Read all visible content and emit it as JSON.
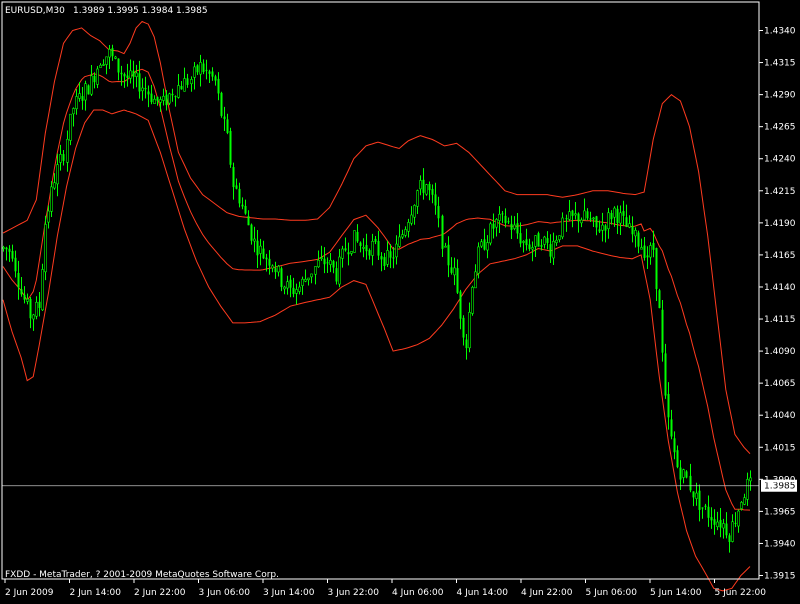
{
  "header": {
    "symbol_label": "EURUSD,M30",
    "ohlc_label": "1.3989 1.3995 1.3984 1.3985"
  },
  "footer": {
    "copyright": "FXDD - MetaTrader, ? 2001-2009 MetaQuotes Software Corp."
  },
  "colors": {
    "background": "#000000",
    "frame": "#ffffff",
    "bull_candle": "#00ff00",
    "bear_candle": "#00ff00",
    "band": "#ff3b1f",
    "price_line": "#c0c0c0",
    "price_tag_bg": "#ffffff",
    "price_tag_text": "#000000"
  },
  "chart_data": {
    "type": "line",
    "symbol": "EURUSD",
    "timeframe": "M30",
    "ylim": [
      1.3905,
      1.4355
    ],
    "y_ticks": [
      "1.4340",
      "1.4315",
      "1.4290",
      "1.4265",
      "1.4240",
      "1.4215",
      "1.4190",
      "1.4165",
      "1.4140",
      "1.4115",
      "1.4090",
      "1.4065",
      "1.4040",
      "1.4015",
      "1.3990",
      "1.3965",
      "1.3940",
      "1.3915"
    ],
    "x_ticks": [
      "2 Jun 2009",
      "2 Jun 14:00",
      "2 Jun 22:00",
      "3 Jun 06:00",
      "3 Jun 14:00",
      "3 Jun 22:00",
      "4 Jun 06:00",
      "4 Jun 14:00",
      "4 Jun 22:00",
      "5 Jun 06:00",
      "5 Jun 14:00",
      "5 Jun 22:00"
    ],
    "current_price": "1.3985",
    "price_series_knots": [
      [
        0,
        1.417
      ],
      [
        3,
        1.4168
      ],
      [
        6,
        1.4135
      ],
      [
        9,
        1.4118
      ],
      [
        12,
        1.4125
      ],
      [
        14,
        1.419
      ],
      [
        17,
        1.4225
      ],
      [
        20,
        1.4245
      ],
      [
        23,
        1.428
      ],
      [
        26,
        1.429
      ],
      [
        29,
        1.43
      ],
      [
        32,
        1.4318
      ],
      [
        35,
        1.4322
      ],
      [
        38,
        1.431
      ],
      [
        41,
        1.4303
      ],
      [
        44,
        1.43
      ],
      [
        47,
        1.4295
      ],
      [
        50,
        1.4286
      ],
      [
        53,
        1.4283
      ],
      [
        56,
        1.4293
      ],
      [
        59,
        1.4298
      ],
      [
        62,
        1.4302
      ],
      [
        65,
        1.4312
      ],
      [
        68,
        1.4305
      ],
      [
        70,
        1.43
      ],
      [
        72,
        1.4275
      ],
      [
        74,
        1.4255
      ],
      [
        76,
        1.422
      ],
      [
        78,
        1.421
      ],
      [
        80,
        1.4195
      ],
      [
        83,
        1.4175
      ],
      [
        86,
        1.4165
      ],
      [
        89,
        1.416
      ],
      [
        92,
        1.4145
      ],
      [
        95,
        1.4137
      ],
      [
        98,
        1.414
      ],
      [
        101,
        1.415
      ],
      [
        104,
        1.4158
      ],
      [
        107,
        1.416
      ],
      [
        110,
        1.415
      ],
      [
        113,
        1.417
      ],
      [
        116,
        1.4177
      ],
      [
        119,
        1.417
      ],
      [
        122,
        1.4172
      ],
      [
        125,
        1.4165
      ],
      [
        128,
        1.416
      ],
      [
        131,
        1.4175
      ],
      [
        134,
        1.4195
      ],
      [
        137,
        1.4215
      ],
      [
        140,
        1.422
      ],
      [
        143,
        1.42
      ],
      [
        146,
        1.4165
      ],
      [
        149,
        1.415
      ],
      [
        151,
        1.412
      ],
      [
        153,
        1.4095
      ],
      [
        155,
        1.4145
      ],
      [
        157,
        1.4165
      ],
      [
        160,
        1.418
      ],
      [
        163,
        1.419
      ],
      [
        166,
        1.4192
      ],
      [
        169,
        1.4185
      ],
      [
        172,
        1.4175
      ],
      [
        175,
        1.4172
      ],
      [
        178,
        1.4178
      ],
      [
        181,
        1.417
      ],
      [
        184,
        1.4185
      ],
      [
        187,
        1.4192
      ],
      [
        190,
        1.4195
      ],
      [
        193,
        1.4193
      ],
      [
        196,
        1.4185
      ],
      [
        199,
        1.419
      ],
      [
        202,
        1.42
      ],
      [
        205,
        1.419
      ],
      [
        208,
        1.418
      ],
      [
        211,
        1.4173
      ],
      [
        213,
        1.4165
      ],
      [
        215,
        1.417
      ],
      [
        217,
        1.412
      ],
      [
        219,
        1.405
      ],
      [
        221,
        1.402
      ],
      [
        223,
        1.4
      ],
      [
        226,
        1.399
      ],
      [
        229,
        1.3975
      ],
      [
        232,
        1.3965
      ],
      [
        235,
        1.396
      ],
      [
        238,
        1.3955
      ],
      [
        240,
        1.3948
      ],
      [
        242,
        1.396
      ],
      [
        244,
        1.3975
      ],
      [
        246,
        1.3985
      ]
    ],
    "band_upper_knots": [
      [
        0,
        1.4182
      ],
      [
        4,
        1.4187
      ],
      [
        8,
        1.4192
      ],
      [
        11,
        1.4208
      ],
      [
        14,
        1.426
      ],
      [
        17,
        1.43
      ],
      [
        20,
        1.433
      ],
      [
        23,
        1.434
      ],
      [
        26,
        1.4342
      ],
      [
        29,
        1.4336
      ],
      [
        32,
        1.4332
      ],
      [
        35,
        1.4325
      ],
      [
        38,
        1.4324
      ],
      [
        40,
        1.4322
      ],
      [
        42,
        1.433
      ],
      [
        44,
        1.4342
      ],
      [
        46,
        1.4347
      ],
      [
        48,
        1.4345
      ],
      [
        50,
        1.4335
      ],
      [
        52,
        1.4315
      ],
      [
        55,
        1.4278
      ],
      [
        58,
        1.4245
      ],
      [
        62,
        1.4225
      ],
      [
        66,
        1.4212
      ],
      [
        70,
        1.4205
      ],
      [
        74,
        1.4198
      ],
      [
        78,
        1.4195
      ],
      [
        82,
        1.4194
      ],
      [
        86,
        1.4193
      ],
      [
        90,
        1.4193
      ],
      [
        95,
        1.4192
      ],
      [
        100,
        1.4192
      ],
      [
        104,
        1.4193
      ],
      [
        108,
        1.4202
      ],
      [
        112,
        1.422
      ],
      [
        116,
        1.424
      ],
      [
        120,
        1.425
      ],
      [
        124,
        1.4253
      ],
      [
        128,
        1.425
      ],
      [
        131,
        1.4248
      ],
      [
        134,
        1.4254
      ],
      [
        138,
        1.4258
      ],
      [
        142,
        1.4255
      ],
      [
        146,
        1.425
      ],
      [
        150,
        1.4252
      ],
      [
        154,
        1.4245
      ],
      [
        158,
        1.4235
      ],
      [
        162,
        1.4225
      ],
      [
        166,
        1.4215
      ],
      [
        170,
        1.4212
      ],
      [
        175,
        1.4212
      ],
      [
        180,
        1.4212
      ],
      [
        185,
        1.421
      ],
      [
        190,
        1.4212
      ],
      [
        195,
        1.4215
      ],
      [
        200,
        1.4215
      ],
      [
        205,
        1.4213
      ],
      [
        209,
        1.4212
      ],
      [
        212,
        1.4214
      ],
      [
        215,
        1.4255
      ],
      [
        218,
        1.4283
      ],
      [
        221,
        1.429
      ],
      [
        224,
        1.4285
      ],
      [
        227,
        1.4265
      ],
      [
        230,
        1.423
      ],
      [
        233,
        1.418
      ],
      [
        236,
        1.412
      ],
      [
        239,
        1.406
      ],
      [
        242,
        1.4025
      ],
      [
        245,
        1.4015
      ],
      [
        247,
        1.401
      ]
    ],
    "band_lower_knots": [
      [
        0,
        1.413
      ],
      [
        3,
        1.4105
      ],
      [
        6,
        1.4085
      ],
      [
        8,
        1.4067
      ],
      [
        10,
        1.407
      ],
      [
        12,
        1.4095
      ],
      [
        15,
        1.4135
      ],
      [
        18,
        1.418
      ],
      [
        21,
        1.4218
      ],
      [
        24,
        1.4248
      ],
      [
        27,
        1.4268
      ],
      [
        30,
        1.4278
      ],
      [
        33,
        1.4278
      ],
      [
        36,
        1.4275
      ],
      [
        40,
        1.4278
      ],
      [
        44,
        1.4275
      ],
      [
        48,
        1.427
      ],
      [
        52,
        1.4245
      ],
      [
        56,
        1.4215
      ],
      [
        60,
        1.4185
      ],
      [
        64,
        1.416
      ],
      [
        68,
        1.414
      ],
      [
        72,
        1.4125
      ],
      [
        76,
        1.4112
      ],
      [
        80,
        1.4112
      ],
      [
        85,
        1.4113
      ],
      [
        90,
        1.4118
      ],
      [
        95,
        1.4125
      ],
      [
        100,
        1.4128
      ],
      [
        104,
        1.413
      ],
      [
        108,
        1.4132
      ],
      [
        112,
        1.414
      ],
      [
        116,
        1.4145
      ],
      [
        120,
        1.4142
      ],
      [
        123,
        1.4125
      ],
      [
        126,
        1.4108
      ],
      [
        129,
        1.409
      ],
      [
        133,
        1.4092
      ],
      [
        137,
        1.4095
      ],
      [
        141,
        1.41
      ],
      [
        145,
        1.411
      ],
      [
        149,
        1.4123
      ],
      [
        153,
        1.4138
      ],
      [
        157,
        1.415
      ],
      [
        161,
        1.4158
      ],
      [
        165,
        1.416
      ],
      [
        169,
        1.4162
      ],
      [
        173,
        1.4165
      ],
      [
        177,
        1.417
      ],
      [
        181,
        1.4168
      ],
      [
        185,
        1.4172
      ],
      [
        190,
        1.4172
      ],
      [
        195,
        1.4168
      ],
      [
        200,
        1.4165
      ],
      [
        204,
        1.4163
      ],
      [
        208,
        1.4162
      ],
      [
        211,
        1.4165
      ],
      [
        214,
        1.413
      ],
      [
        217,
        1.407
      ],
      [
        220,
        1.402
      ],
      [
        223,
        1.398
      ],
      [
        226,
        1.395
      ],
      [
        229,
        1.393
      ],
      [
        232,
        1.3918
      ],
      [
        235,
        1.3905
      ],
      [
        238,
        1.3903
      ],
      [
        241,
        1.3905
      ],
      [
        244,
        1.3915
      ],
      [
        247,
        1.3922
      ]
    ],
    "bar_count": 248,
    "plot_area_note": "candlestick bars with Bollinger bands"
  }
}
